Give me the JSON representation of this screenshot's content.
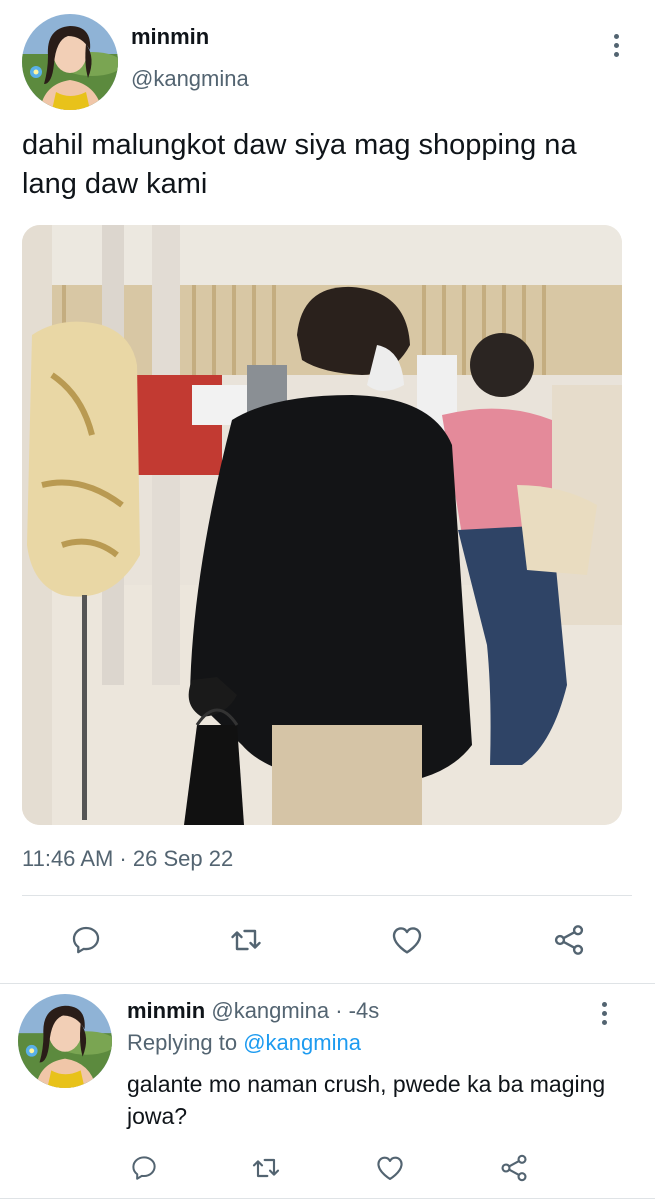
{
  "tweet": {
    "display_name": "minmin",
    "handle": "@kangmina",
    "more_icon": "more-vertical-icon",
    "text": "dahil malungkot daw siya mag shopping na lang daw kami",
    "timestamp": "11:46 AM · 26 Sep 22",
    "actions": {
      "reply_icon": "reply-icon",
      "retweet_icon": "retweet-icon",
      "like_icon": "heart-icon",
      "share_icon": "share-icon"
    }
  },
  "reply": {
    "display_name": "minmin",
    "handle": "@kangmina",
    "time": "· -4s",
    "replying_to_label": "Replying to",
    "replying_to_handle": "@kangmina",
    "text": "galante mo naman crush, pwede ka ba maging jowa?",
    "more_icon": "more-vertical-icon",
    "actions": {
      "reply_icon": "reply-icon",
      "retweet_icon": "retweet-icon",
      "like_icon": "heart-icon",
      "share_icon": "share-icon"
    }
  },
  "colors": {
    "text_primary": "#0f1419",
    "text_secondary": "#536471",
    "accent": "#1d9bf0",
    "divider": "#dfe3e6"
  }
}
